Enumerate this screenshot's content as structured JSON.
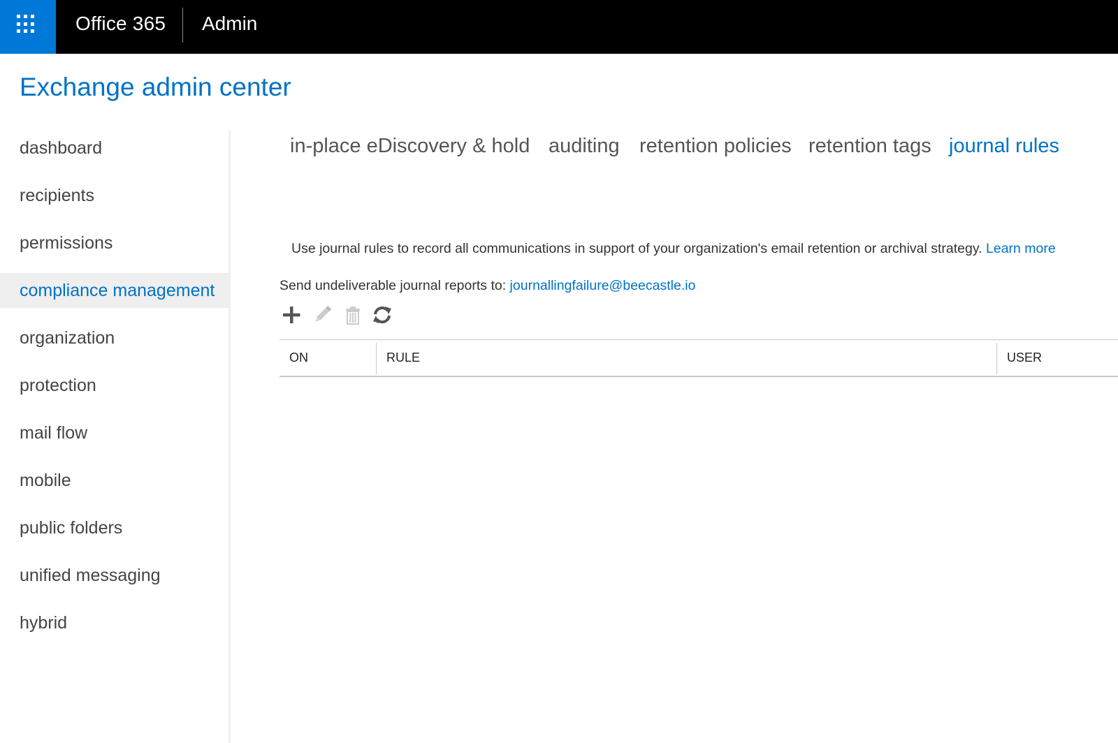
{
  "topbar": {
    "brand": "Office 365",
    "app": "Admin",
    "colors": {
      "bar": "#000000",
      "waffle": "#0078d7"
    }
  },
  "page": {
    "title": "Exchange admin center",
    "accent_color": "#0072c6"
  },
  "sidebar": {
    "items": [
      {
        "label": "dashboard"
      },
      {
        "label": "recipients"
      },
      {
        "label": "permissions"
      },
      {
        "label": "compliance management",
        "active": true
      },
      {
        "label": "organization"
      },
      {
        "label": "protection"
      },
      {
        "label": "mail flow"
      },
      {
        "label": "mobile"
      },
      {
        "label": "public folders"
      },
      {
        "label": "unified messaging"
      },
      {
        "label": "hybrid"
      }
    ]
  },
  "tabs": [
    {
      "label": "in-place eDiscovery & hold"
    },
    {
      "label": "auditing"
    },
    {
      "label": "retention policies"
    },
    {
      "label": "retention tags"
    },
    {
      "label": "journal rules",
      "active": true
    }
  ],
  "content": {
    "description": "Use journal rules to record all communications in support of your organization's email retention or archival strategy.",
    "learn_more": "Learn more",
    "send_label": "Send undeliverable journal reports to:",
    "send_address": "journallingfailure@beecastle.io"
  },
  "toolbar": {
    "icons": [
      "add-icon",
      "edit-icon",
      "delete-icon",
      "refresh-icon"
    ]
  },
  "table": {
    "columns": [
      "ON",
      "RULE",
      "USER"
    ]
  }
}
